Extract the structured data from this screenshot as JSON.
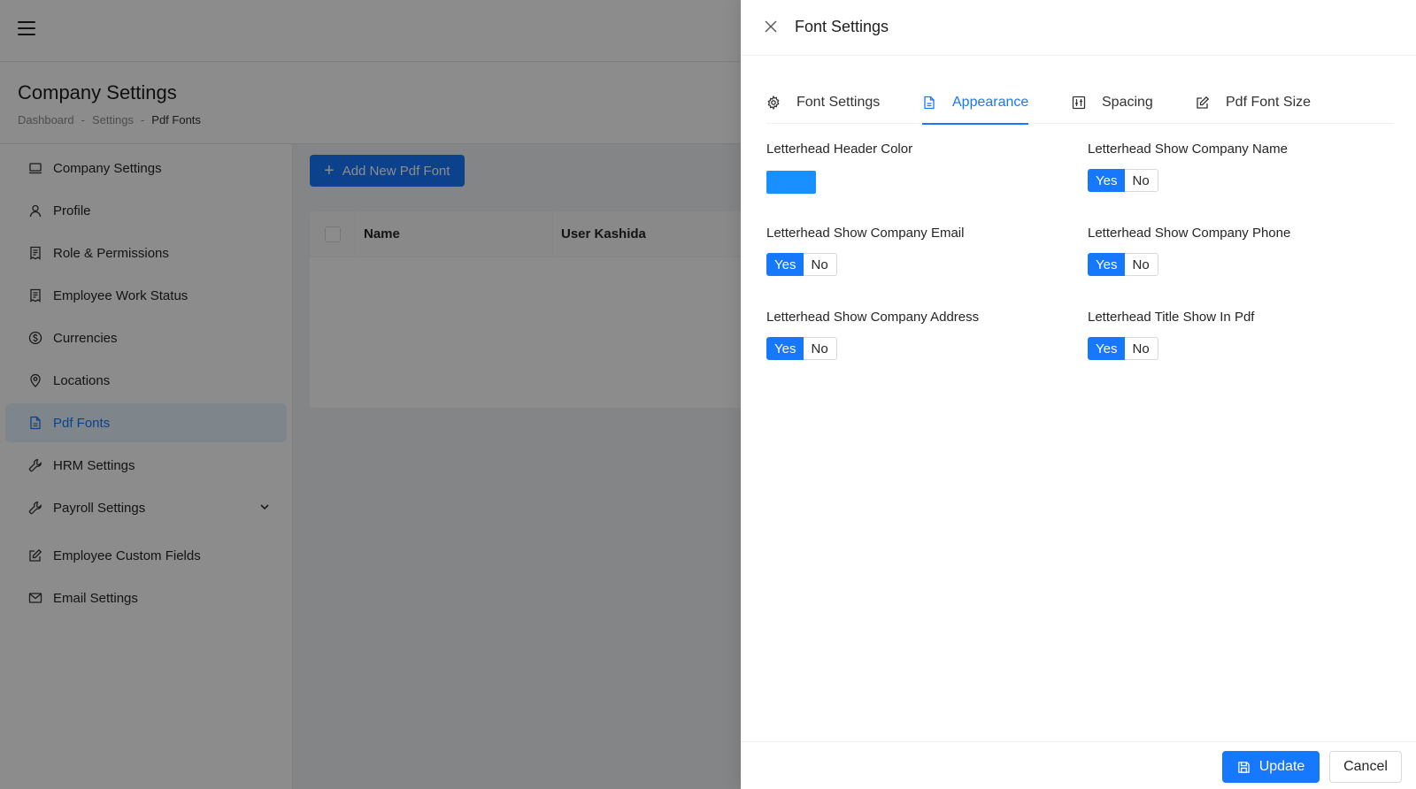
{
  "app": {
    "page_title": "Company Settings",
    "breadcrumb": [
      "Dashboard",
      "Settings",
      "Pdf Fonts"
    ],
    "breadcrumb_sep": "-"
  },
  "sidebar": {
    "items": [
      {
        "label": "Company Settings",
        "icon": "laptop-icon"
      },
      {
        "label": "Profile",
        "icon": "user-icon"
      },
      {
        "label": "Role & Permissions",
        "icon": "shield-list-icon"
      },
      {
        "label": "Employee Work Status",
        "icon": "shield-list-icon"
      },
      {
        "label": "Currencies",
        "icon": "dollar-circle-icon"
      },
      {
        "label": "Locations",
        "icon": "location-pin-icon"
      },
      {
        "label": "Pdf Fonts",
        "icon": "file-pdf-icon",
        "active": true
      },
      {
        "label": "HRM Settings",
        "icon": "tool-icon"
      },
      {
        "label": "Payroll Settings",
        "icon": "tool-icon",
        "has_submenu": true
      },
      {
        "label": "Employee Custom Fields",
        "icon": "edit-icon"
      },
      {
        "label": "Email Settings",
        "icon": "mail-icon"
      }
    ]
  },
  "content": {
    "add_button_label": "Add New Pdf Font",
    "table_columns": [
      "Name",
      "User Kashida"
    ]
  },
  "drawer": {
    "title": "Font Settings",
    "tabs": [
      {
        "label": "Font Settings",
        "icon": "gear-icon"
      },
      {
        "label": "Appearance",
        "icon": "file-icon",
        "active": true
      },
      {
        "label": "Spacing",
        "icon": "sliders-icon"
      },
      {
        "label": "Pdf Font Size",
        "icon": "edit-icon"
      }
    ],
    "fields": {
      "header_color": {
        "label": "Letterhead Header Color",
        "value": "#1890ff"
      },
      "show_company_name": {
        "label": "Letterhead Show Company Name",
        "value": "Yes"
      },
      "show_company_email": {
        "label": "Letterhead Show Company Email",
        "value": "Yes"
      },
      "show_company_phone": {
        "label": "Letterhead Show Company Phone",
        "value": "Yes"
      },
      "show_company_address": {
        "label": "Letterhead Show Company Address",
        "value": "Yes"
      },
      "title_show_in_pdf": {
        "label": "Letterhead Title Show In Pdf",
        "value": "Yes"
      }
    },
    "toggle_yes": "Yes",
    "toggle_no": "No",
    "footer": {
      "update_label": "Update",
      "cancel_label": "Cancel"
    }
  },
  "colors": {
    "accent": "#1677ff",
    "swatch": "#1890ff"
  }
}
